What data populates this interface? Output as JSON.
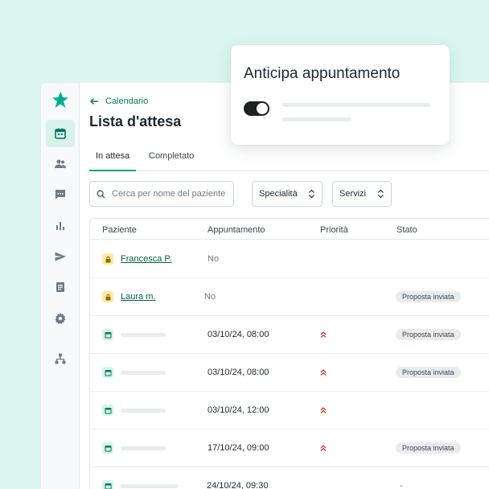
{
  "header": {
    "back_label": "Calendario",
    "title": "Lista d'attesa"
  },
  "tabs": [
    {
      "label": "In attesa"
    },
    {
      "label": "Completato"
    }
  ],
  "search": {
    "placeholder": "Cerca per nome del paziente"
  },
  "filters": [
    {
      "label": "Specialità"
    },
    {
      "label": "Servizi"
    }
  ],
  "table": {
    "columns": [
      "Paziente",
      "Appuntamento",
      "Priorità",
      "Stato"
    ],
    "rows": [
      {
        "icon": "lock-icon",
        "patient": "Francesca P.",
        "appointment": "No",
        "priority": "",
        "status": ""
      },
      {
        "icon": "lock-icon",
        "patient": "Laura m.",
        "appointment": "No",
        "priority": "",
        "status": "Proposta inviata"
      },
      {
        "icon": "calendar-icon",
        "patient": "",
        "appointment": "03/10/24, 08:00",
        "priority": "high",
        "status": "Proposta inviata"
      },
      {
        "icon": "calendar-icon",
        "patient": "",
        "appointment": "03/10/24, 08:00",
        "priority": "high",
        "status": "Proposta inviata"
      },
      {
        "icon": "calendar-icon",
        "patient": "",
        "appointment": "03/10/24, 12:00",
        "priority": "high",
        "status": ""
      },
      {
        "icon": "calendar-icon",
        "patient": "",
        "appointment": "17/10/24, 09:00",
        "priority": "high",
        "status": "Proposta inviata"
      },
      {
        "icon": "calendar-icon",
        "patient": "",
        "appointment": "24/10/24, 09:30",
        "priority": "",
        "status": "-"
      }
    ]
  },
  "card": {
    "title": "Anticipa appuntamento",
    "toggle_on": true
  },
  "sidebar": {
    "items": [
      {
        "icon": "calendar-icon",
        "active": true
      },
      {
        "icon": "users-icon"
      },
      {
        "icon": "chat-icon"
      },
      {
        "icon": "bar-chart-icon"
      },
      {
        "icon": "send-icon"
      },
      {
        "icon": "document-icon"
      },
      {
        "icon": "gear-icon"
      },
      {
        "icon": "org-chart-icon"
      }
    ]
  },
  "colors": {
    "accent": "#00a383",
    "link": "#00785e",
    "priority": "#c0392b",
    "background": "#dbf6f0"
  }
}
